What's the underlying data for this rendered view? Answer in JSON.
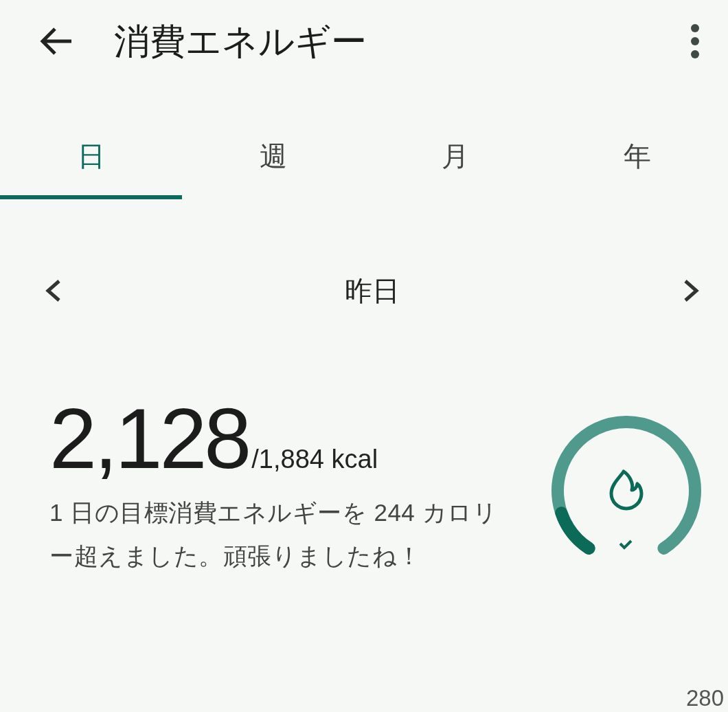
{
  "app_bar": {
    "title": "消費エネルギー"
  },
  "tabs": [
    {
      "label": "日",
      "selected": true
    },
    {
      "label": "週",
      "selected": false
    },
    {
      "label": "月",
      "selected": false
    },
    {
      "label": "年",
      "selected": false
    }
  ],
  "date_nav": {
    "label": "昨日"
  },
  "summary": {
    "value": "2,128",
    "goal": "/1,884 kcal",
    "message": "1 日の目標消費エネルギーを 244 カロリー超えました。頑張りましたね！"
  },
  "gauge": {
    "arcs": [
      {
        "kind": "goal"
      },
      {
        "kind": "overflow"
      }
    ],
    "goal_met": true
  },
  "footer": {
    "number": "280"
  }
}
